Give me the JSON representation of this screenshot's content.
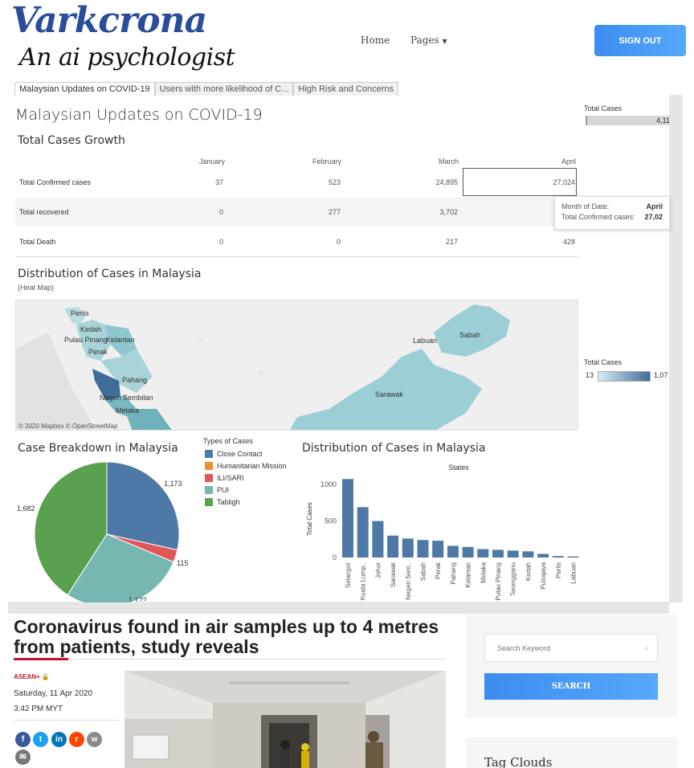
{
  "header": {
    "logo_title": "Varkcrona",
    "logo_subtitle": "An ai psychologist",
    "nav": {
      "home": "Home",
      "pages": "Pages"
    },
    "signout_label": "SIGN OUT",
    "accent_color": "#4a9af6"
  },
  "dashboard": {
    "tabs": [
      "Malaysian Updates on COVID-19",
      "Users with more likelihood of C...",
      "High Risk and Concerns"
    ],
    "title": "Malaysian Updates on COVID-19",
    "table": {
      "title": "Total Cases Growth",
      "columns": [
        "January",
        "February",
        "March",
        "April"
      ],
      "rows": [
        {
          "label": "Total Confirmed cases",
          "values": [
            "37",
            "523",
            "24,895",
            "27,024"
          ]
        },
        {
          "label": "Total recovered",
          "values": [
            "0",
            "277",
            "3,702",
            ""
          ]
        },
        {
          "label": "Total Death",
          "values": [
            "0",
            "0",
            "217",
            "428"
          ]
        }
      ]
    },
    "total_cases_bar": {
      "label": "Total Cases",
      "value": "4,11"
    },
    "tooltip": {
      "row1_label": "Month of Date:",
      "row1_value": "April",
      "row2_label": "Total Confirmed cases:",
      "row2_value": "27,02"
    },
    "map": {
      "title": "Distribution of Cases in Malaysia",
      "subtitle": "(Heat Map)",
      "labels": [
        "Perlis",
        "Kedah",
        "Pulau Pinang",
        "Kelantan",
        "Perak",
        "Pahang",
        "Negeri Sembilan",
        "Melaka",
        "Labuan",
        "Sabah",
        "Sarawak"
      ],
      "attribution": "© 2020 Mapbox  © OpenStreetMap",
      "legend": {
        "title": "Total Cases",
        "min": "13",
        "max": "1,07"
      }
    },
    "pie": {
      "title": "Case Breakdown in Malaysia",
      "legend_title": "Types of Cases",
      "labels": [
        "1,173",
        "115",
        "1,682",
        "1,1??"
      ]
    },
    "bar": {
      "title": "Distribution of Cases in Malaysia",
      "subtitle": "States",
      "ylabel": "Total Cases"
    }
  },
  "chart_data": [
    {
      "type": "pie",
      "title": "Case Breakdown in Malaysia",
      "series": [
        {
          "name": "Close Contact",
          "value": 1173,
          "color": "#4e79a7"
        },
        {
          "name": "Humanitarian Mission",
          "value": 0,
          "color": "#f28e2b"
        },
        {
          "name": "ILI/SARI",
          "value": 115,
          "color": "#e15759"
        },
        {
          "name": "PUI",
          "value": 1147,
          "color": "#76b7b2"
        },
        {
          "name": "Tabligh",
          "value": 1682,
          "color": "#59a14f"
        }
      ]
    },
    {
      "type": "bar",
      "title": "Distribution of Cases in Malaysia",
      "xlabel": "States",
      "ylabel": "Total Cases",
      "ylim": [
        0,
        1100
      ],
      "yticks": [
        "1000",
        "500",
        "0"
      ],
      "categories": [
        "Selangor",
        "Kuala Lump..",
        "Johor",
        "Sarawak",
        "Negeri Sem..",
        "Sabah",
        "Perak",
        "Pahang",
        "Kelantan",
        "Melaka",
        "Pulau Pinang",
        "Terengganu",
        "Kedah",
        "Putrajaya",
        "Perlis",
        "Labuan"
      ],
      "values": [
        1075,
        690,
        500,
        300,
        260,
        240,
        230,
        160,
        145,
        115,
        105,
        95,
        85,
        50,
        20,
        15
      ],
      "color": "#4e79a7"
    }
  ],
  "article": {
    "title": "Coronavirus found in air samples up to 4 metres from patients, study reveals",
    "tag": "ASEAN+",
    "date": "Saturday, 11 Apr 2020",
    "time": "3:42 PM MYT",
    "social_icons": [
      "facebook-icon",
      "twitter-icon",
      "linkedin-icon",
      "reddit-icon",
      "wechat-icon",
      "email-icon"
    ]
  },
  "sidebar": {
    "search_placeholder": "Search Keyword",
    "search_button": "SEARCH",
    "tag_clouds_title": "Tag Clouds"
  }
}
